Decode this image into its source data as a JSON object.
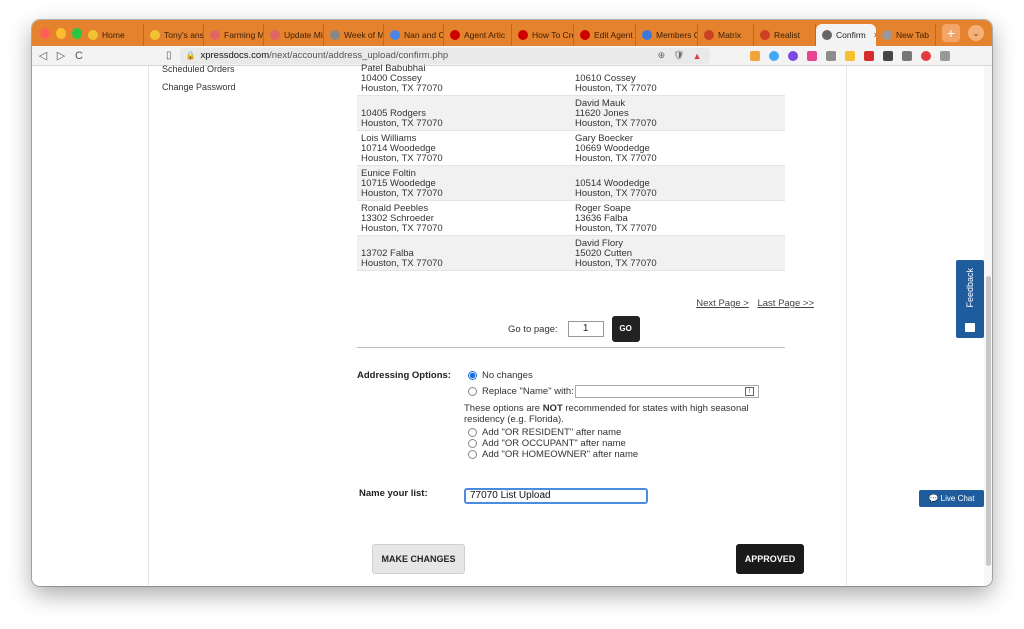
{
  "browser": {
    "tabs": [
      {
        "label": "Home",
        "color": "#f1c232"
      },
      {
        "label": "Tony's answ",
        "color": "#f1c232"
      },
      {
        "label": "Farming Ma",
        "color": "#e06666"
      },
      {
        "label": "Update Mic",
        "color": "#e06666"
      },
      {
        "label": "Week of Ma",
        "color": "#888888"
      },
      {
        "label": "Nan and Co",
        "color": "#4a86e8"
      },
      {
        "label": "Agent Artic",
        "color": "#cc0000"
      },
      {
        "label": "How To Cre",
        "color": "#cc0000"
      },
      {
        "label": "Edit Agent",
        "color": "#cc0000"
      },
      {
        "label": "Members C",
        "color": "#3c78d8"
      },
      {
        "label": "Matrix",
        "color": "#cc4125"
      },
      {
        "label": "Realist",
        "color": "#cc4125"
      },
      {
        "label": "Confirm",
        "color": "#666666",
        "active": true
      },
      {
        "label": "New Tab",
        "color": "#999999"
      }
    ],
    "tab_close": "×",
    "new_tab": "+",
    "tab_menu": "⌄",
    "nav_back": "◁",
    "nav_forward": "▷",
    "nav_reload": "C",
    "bookmark_icon": "▯",
    "lock_icon": "🔒",
    "url_host": "xpressdocs.com",
    "url_path": "/next/account/address_upload/confirm.php",
    "url_zoom_icon": "⊕",
    "url_brave_icon": "🛡",
    "url_warn_icon": "▲"
  },
  "sidebar": {
    "items": [
      "Scheduled Orders",
      "Change Password"
    ]
  },
  "addresses": {
    "rows": [
      {
        "left": [
          "Patel Babubhai",
          "10400 Cossey",
          "Houston, TX 77070"
        ],
        "right": [
          "10610 Cossey",
          "Houston, TX 77070"
        ],
        "shade": false
      },
      {
        "left": [
          "10405 Rodgers",
          "Houston, TX 77070"
        ],
        "right": [
          "David Mauk",
          "11620 Jones",
          "Houston, TX 77070"
        ],
        "shade": true
      },
      {
        "left": [
          "Lois Williams",
          "10714 Woodedge",
          "Houston, TX 77070"
        ],
        "right": [
          "Gary Boecker",
          "10669 Woodedge",
          "Houston, TX 77070"
        ],
        "shade": false
      },
      {
        "left": [
          "Eunice Foltin",
          "10715 Woodedge",
          "Houston, TX 77070"
        ],
        "right": [
          "10514 Woodedge",
          "Houston, TX 77070"
        ],
        "shade": true
      },
      {
        "left": [
          "Ronald Peebles",
          "13302 Schroeder",
          "Houston, TX 77070"
        ],
        "right": [
          "Roger Soape",
          "13636 Falba",
          "Houston, TX 77070"
        ],
        "shade": false
      },
      {
        "left": [
          "13702 Falba",
          "Houston, TX 77070"
        ],
        "right": [
          "David Flory",
          "15020 Cutten",
          "Houston, TX 77070"
        ],
        "shade": true
      }
    ]
  },
  "pager": {
    "next": "Next Page >",
    "last": "Last Page >>",
    "goto_label": "Go to page:",
    "page_value": "1",
    "go_label": "GO"
  },
  "options": {
    "title": "Addressing Options:",
    "no_changes": "No changes",
    "replace_name": "Replace \"Name\" with:",
    "replace_value": "",
    "replace_kbd": "!",
    "note_pre": "These options are ",
    "note_bold": "NOT",
    "note_post": " recommended for states with high seasonal residency (e.g. Florida).",
    "or_resident": "Add \"OR RESIDENT\" after name",
    "or_occupant": "Add \"OR OCCUPANT\" after name",
    "or_homeowner": "Add \"OR HOMEOWNER\" after name"
  },
  "list_name": {
    "label": "Name your list:",
    "value": "77070 List Upload"
  },
  "actions": {
    "make_changes": "MAKE CHANGES",
    "approved": "APPROVED"
  },
  "widgets": {
    "feedback": "Feedback",
    "live_chat": "💬 Live Chat"
  }
}
